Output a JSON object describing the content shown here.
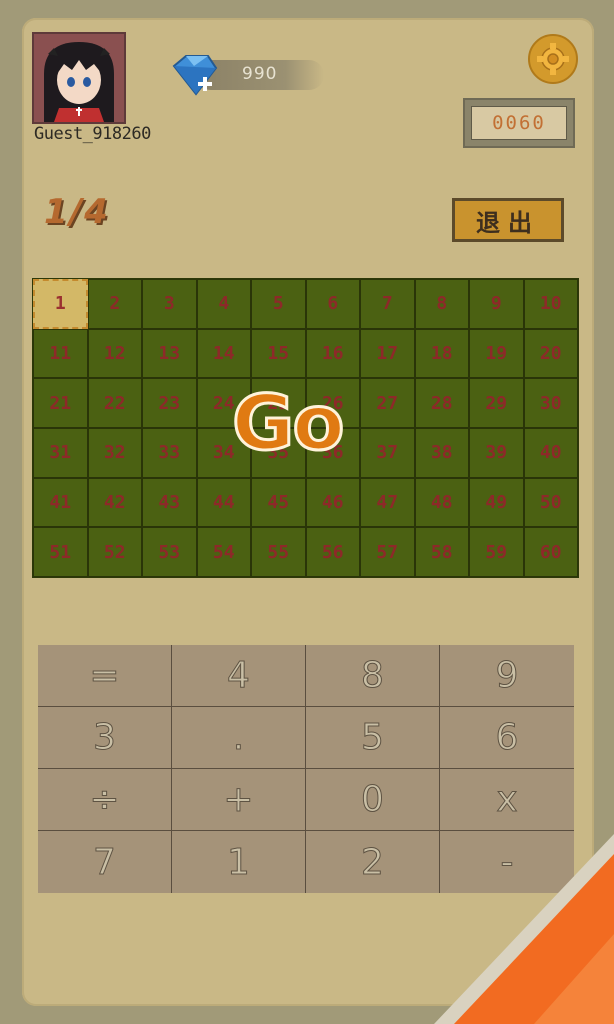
{
  "player": {
    "username": "Guest_918260"
  },
  "currency": {
    "gems": "990"
  },
  "timer": {
    "value": "0060"
  },
  "level": {
    "progress": "1/4"
  },
  "buttons": {
    "exit": "退出",
    "go": "Go"
  },
  "grid": {
    "cells": [
      "1",
      "2",
      "3",
      "4",
      "5",
      "6",
      "7",
      "8",
      "9",
      "10",
      "11",
      "12",
      "13",
      "14",
      "15",
      "16",
      "17",
      "18",
      "19",
      "20",
      "21",
      "22",
      "23",
      "24",
      "25",
      "26",
      "27",
      "28",
      "29",
      "30",
      "31",
      "32",
      "33",
      "34",
      "35",
      "36",
      "37",
      "38",
      "39",
      "40",
      "41",
      "42",
      "43",
      "44",
      "45",
      "46",
      "47",
      "48",
      "49",
      "50",
      "51",
      "52",
      "53",
      "54",
      "55",
      "56",
      "57",
      "58",
      "59",
      "60"
    ],
    "active_index": 0
  },
  "keypad": {
    "keys": [
      "=",
      "4",
      "8",
      "9",
      "3",
      ".",
      "5",
      "6",
      "÷",
      "+",
      "0",
      "x",
      "7",
      "1",
      "2",
      "-"
    ]
  },
  "colors": {
    "background": "#a19a78",
    "panel": "#c9b886",
    "grid_cell": "#4b6112",
    "grid_number": "#8d2929",
    "go_text": "#e07a12",
    "accent_orange": "#f26b21"
  },
  "icons": {
    "settings": "gear-icon",
    "gem": "diamond-gem-icon"
  }
}
